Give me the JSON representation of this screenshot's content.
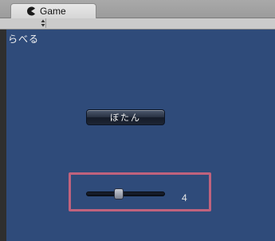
{
  "tab": {
    "title": "Game",
    "icon": "pacman-icon"
  },
  "toolbar": {
    "dropdown_icon": "up-down-arrows-icon"
  },
  "game": {
    "background_color": "#2f4b7a",
    "label": "らべる",
    "button_label": "ぼたん",
    "slider": {
      "min": 0,
      "max": 10,
      "value": 4,
      "value_text": "4"
    },
    "highlight_color": "#c0627d"
  }
}
